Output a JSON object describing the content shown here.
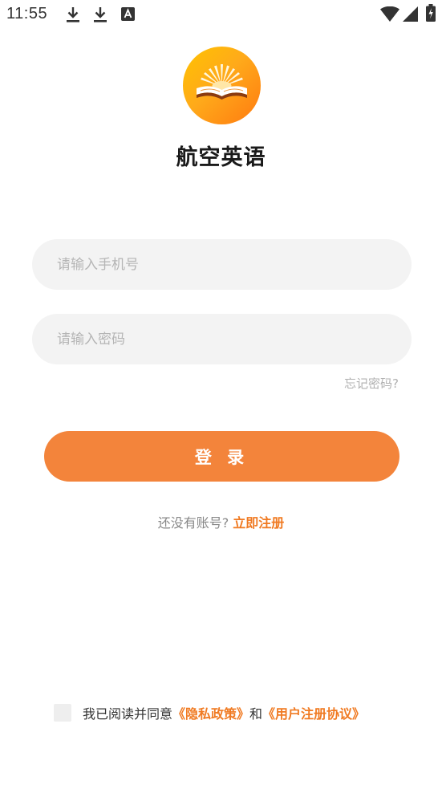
{
  "status_bar": {
    "time": "11:55",
    "icons": [
      "download-icon",
      "download-icon",
      "text-a-icon",
      "wifi-icon",
      "signal-icon",
      "battery-icon"
    ]
  },
  "app": {
    "title": "航空英语",
    "logo_icon": "open-book-sunrise-icon",
    "brand_color": "#f3843b"
  },
  "form": {
    "phone_placeholder": "请输入手机号",
    "phone_value": "",
    "password_placeholder": "请输入密码",
    "password_value": "",
    "forgot_label": "忘记密码?",
    "login_label": "登 录"
  },
  "register": {
    "prompt": "还没有账号?",
    "link_label": "立即注册"
  },
  "agreement": {
    "checked": false,
    "prefix": "我已阅读并同意",
    "privacy_label": "《隐私政策》",
    "connector": "和",
    "terms_label": "《用户注册协议》"
  }
}
